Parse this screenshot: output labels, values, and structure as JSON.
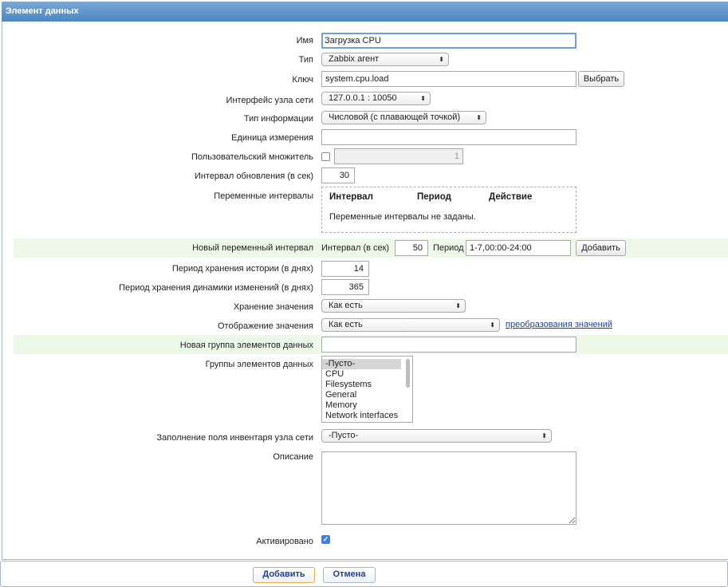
{
  "header": {
    "title": "Элемент данных"
  },
  "form": {
    "name": {
      "label": "Имя",
      "value": "Загрузка CPU"
    },
    "type": {
      "label": "Тип",
      "value": "Zabbix агент"
    },
    "key": {
      "label": "Ключ",
      "value": "system.cpu.load",
      "button": "Выбрать"
    },
    "interface": {
      "label": "Интерфейс узла сети",
      "value": "127.0.0.1 : 10050"
    },
    "info_type": {
      "label": "Тип информации",
      "value": "Числовой (с плавающей точкой)"
    },
    "units": {
      "label": "Единица измерения",
      "value": ""
    },
    "multiplier": {
      "label": "Пользовательский множитель",
      "value": "1",
      "checked": false
    },
    "update_interval": {
      "label": "Интервал обновления (в сек)",
      "value": "30"
    },
    "flex_intervals": {
      "label": "Переменные интервалы",
      "columns": [
        "Интервал",
        "Период",
        "Действие"
      ],
      "empty_text": "Переменные интервалы не заданы."
    },
    "new_flex": {
      "label": "Новый переменный интервал",
      "interval_label": "Интервал (в сек)",
      "interval_value": "50",
      "period_label": "Период",
      "period_value": "1-7,00:00-24:00",
      "add_button": "Добавить"
    },
    "history": {
      "label": "Период хранения истории (в днях)",
      "value": "14"
    },
    "trends": {
      "label": "Период хранения динамики изменений (в днях)",
      "value": "365"
    },
    "store_value": {
      "label": "Хранение значения",
      "value": "Как есть"
    },
    "show_value": {
      "label": "Отображение значения",
      "value": "Как есть",
      "link": "преобразования значений"
    },
    "new_group": {
      "label": "Новая группа элементов данных",
      "value": ""
    },
    "groups": {
      "label": "Группы элементов данных",
      "options": [
        "-Пусто-",
        "CPU",
        "Filesystems",
        "General",
        "Memory",
        "Network interfaces"
      ],
      "selected": "-Пусто-"
    },
    "inventory": {
      "label": "Заполнение поля инвентаря узла сети",
      "value": "-Пусто-"
    },
    "description": {
      "label": "Описание",
      "value": ""
    },
    "enabled": {
      "label": "Активировано",
      "checked": true
    }
  },
  "footer": {
    "add_button": "Добавить",
    "cancel_button": "Отмена"
  },
  "colors": {
    "header": "#4c86c1",
    "highlight_row": "#edf8e8",
    "link": "#1f3f8f",
    "checkbox_on": "#3b82e6"
  }
}
